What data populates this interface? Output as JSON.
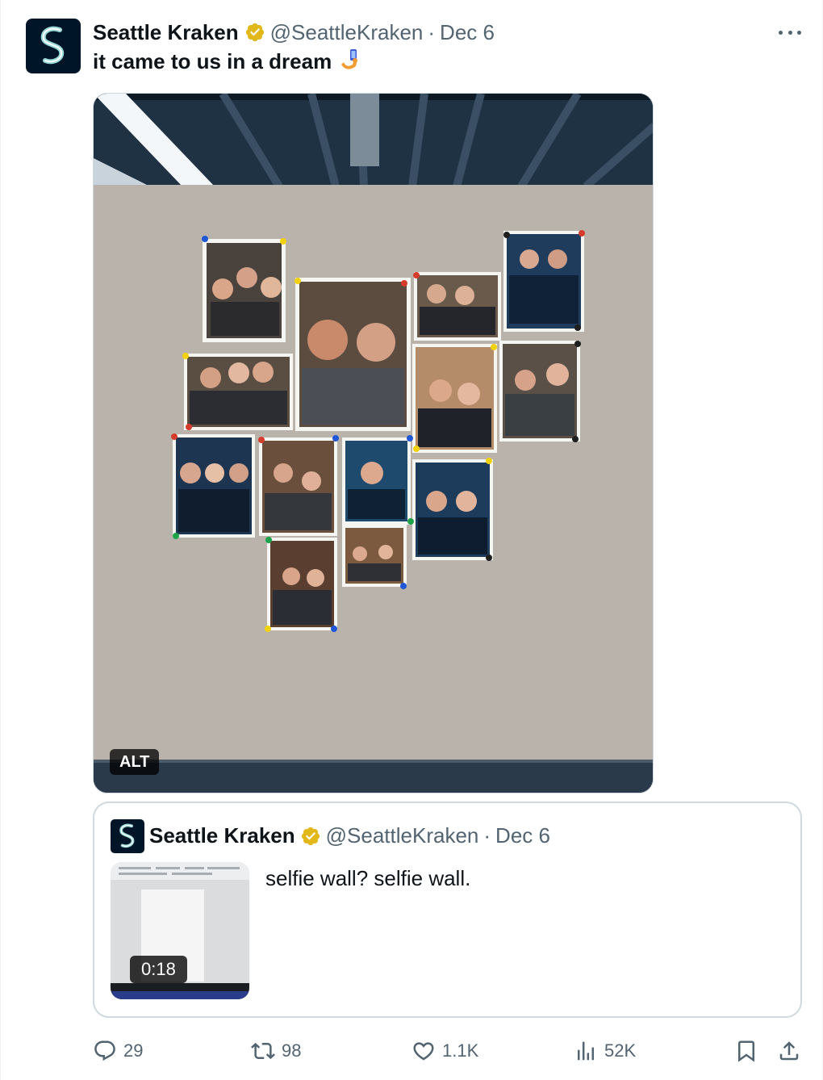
{
  "tweet": {
    "author_name": "Seattle Kraken",
    "handle": "@SeattleKraken",
    "separator": "·",
    "date": "Dec 6",
    "text": "it came to us in a dream",
    "media_alt_badge": "ALT"
  },
  "quoted_tweet": {
    "author_name": "Seattle Kraken",
    "handle": "@SeattleKraken",
    "separator": "·",
    "date": "Dec 6",
    "text": "selfie wall? selfie wall.",
    "video_duration": "0:18"
  },
  "actions": {
    "replies": "29",
    "reposts": "98",
    "likes": "1.1K",
    "views": "52K"
  },
  "icons": {
    "verified": "verified-badge-icon",
    "more": "more-icon",
    "reply": "reply-icon",
    "repost": "repost-icon",
    "like": "heart-icon",
    "views": "views-icon",
    "bookmark": "bookmark-icon",
    "share": "share-icon",
    "emoji": "selfie-emoji-icon"
  },
  "colors": {
    "brand": "#001628",
    "accent": "#99d9d9",
    "verified_gold": "#e2b719",
    "text_secondary": "#536471"
  }
}
